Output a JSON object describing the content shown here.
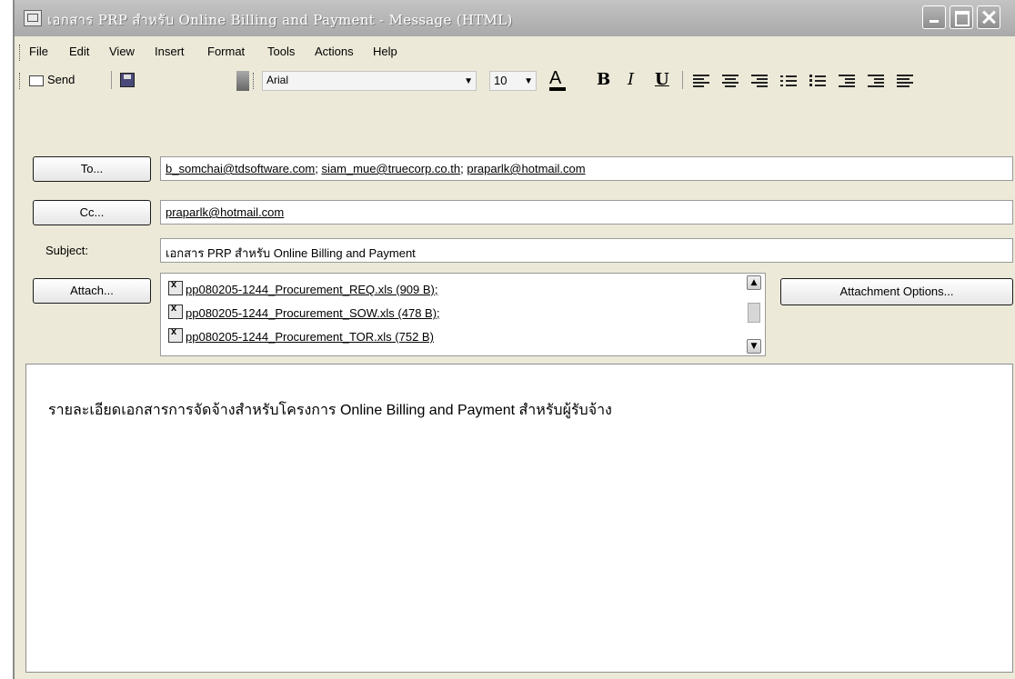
{
  "window": {
    "title": "เอกสาร PRP สำหรับ Online Billing and Payment - Message (HTML)"
  },
  "menu": [
    "File",
    "Edit",
    "View",
    "Insert",
    "Format",
    "Tools",
    "Actions",
    "Help"
  ],
  "toolbar": {
    "send_label": "Send",
    "font_name": "Arial",
    "font_size": "10"
  },
  "header": {
    "to_label": "To...",
    "to_value": "b_somchai@tdsoftware.com; siam_mue@truecorp.co.th; praparlk@hotmail.com",
    "to_addresses": [
      "b_somchai@tdsoftware.com",
      "siam_mue@truecorp.co.th",
      "praparlk@hotmail.com"
    ],
    "cc_label": "Cc...",
    "cc_value": "praparlk@hotmail.com",
    "subject_label": "Subject:",
    "subject_value": "เอกสาร PRP สำหรับ Online Billing and Payment",
    "attach_label": "Attach...",
    "attachment_options_label": "Attachment Options..."
  },
  "attachments": [
    "pp080205-1244_Procurement_REQ.xls (909 B);",
    "pp080205-1244_Procurement_SOW.xls (478 B);",
    "pp080205-1244_Procurement_TOR.xls (752 B)"
  ],
  "body": {
    "text": "รายละเอียดเอกสารการจัดจ้างสำหรับโครงการ Online Billing and Payment สำหรับผู้รับจ้าง"
  }
}
